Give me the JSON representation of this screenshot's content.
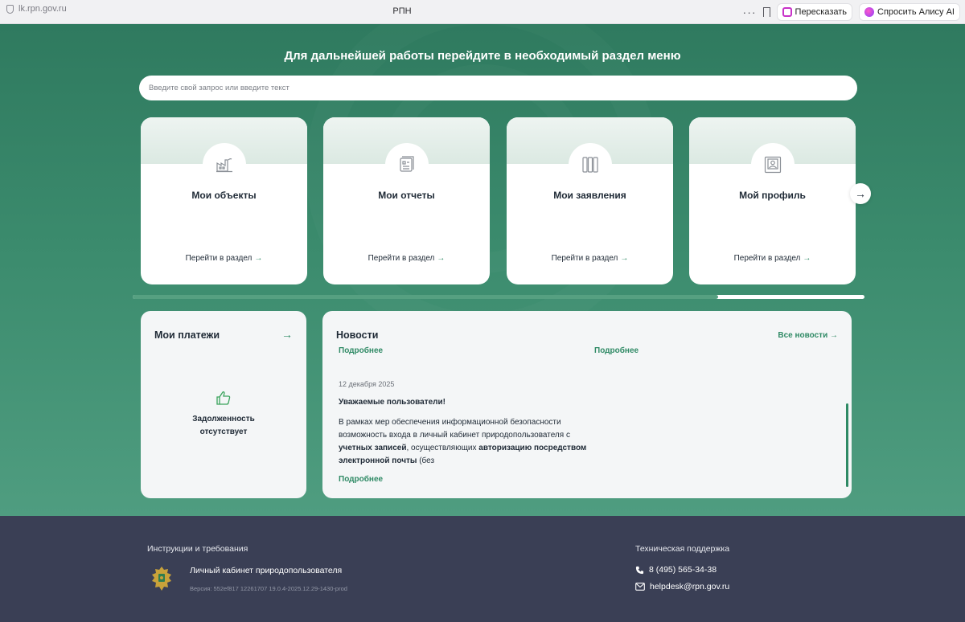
{
  "browser": {
    "url": "lk.rpn.gov.ru",
    "tab_title": "РПН",
    "menu_dots": "···",
    "retell_label": "Пересказать",
    "alice_label": "Спросить Алису AI"
  },
  "hero": {
    "title": "Для дальнейшей работы перейдите в необходимый раздел меню",
    "search_placeholder": "Введите свой запрос или введите текст"
  },
  "cards": [
    {
      "title": "Мои объекты",
      "link": "Перейти в раздел",
      "icon": "factory-icon"
    },
    {
      "title": "Мои отчеты",
      "link": "Перейти в раздел",
      "icon": "reports-icon"
    },
    {
      "title": "Мои заявления",
      "link": "Перейти в раздел",
      "icon": "binders-icon"
    },
    {
      "title": "Мой профиль",
      "link": "Перейти в раздел",
      "icon": "profile-icon"
    }
  ],
  "carousel": {
    "next_icon": "arrow-right-icon",
    "scroll_progress": 0.8
  },
  "payments": {
    "title": "Мои платежи",
    "status_line1": "Задолженность",
    "status_line2": "отсутствует",
    "icon": "thumbs-up-icon"
  },
  "news": {
    "title": "Новости",
    "all_link": "Все новости",
    "more_label": "Подробнее",
    "item": {
      "date": "12 декабря 2025",
      "headline": "Уважаемые пользователи!",
      "body_1": "В рамках мер обеспечения информационной безопасности возможность входа в личный кабинет природопользователя с ",
      "body_bold_1": "учетных записей",
      "body_2": ", осуществляющих ",
      "body_bold_2": "авторизацию посредством электронной почты",
      "body_3": " (без"
    }
  },
  "footer": {
    "instructions": "Инструкции и требования",
    "cabinet": "Личный кабинет природопользователя",
    "version": "Версия: 552ef817 12261707 19.0.4-2025.12.29-1430-prod",
    "support_title": "Техническая поддержка",
    "phone": "8 (495) 565-34-38",
    "email": "helpdesk@rpn.gov.ru"
  },
  "colors": {
    "accent": "#2f8a65",
    "hero_top": "#2f7a5f",
    "footer_bg": "#3a3f55"
  }
}
